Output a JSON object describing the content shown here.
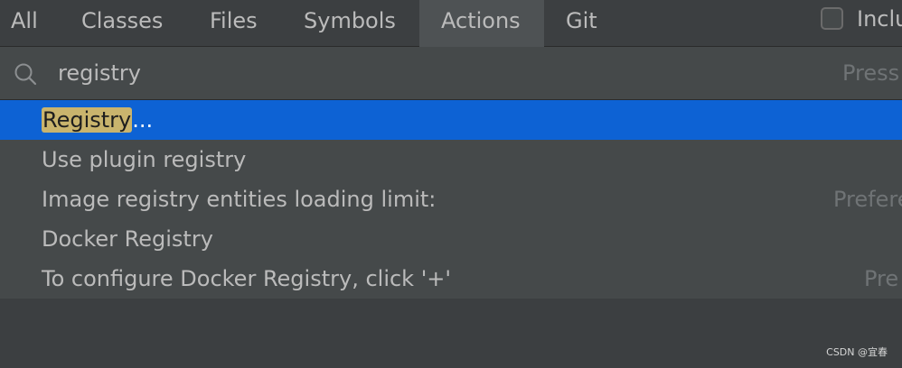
{
  "tabs": [
    {
      "label": "All",
      "active": false
    },
    {
      "label": "Classes",
      "active": false
    },
    {
      "label": "Files",
      "active": false
    },
    {
      "label": "Symbols",
      "active": false
    },
    {
      "label": "Actions",
      "active": true
    },
    {
      "label": "Git",
      "active": false
    }
  ],
  "include": {
    "label": "Inclu",
    "checked": false
  },
  "search": {
    "value": "registry",
    "hint": "Press"
  },
  "results": [
    {
      "match": "Registry",
      "rest": "...",
      "hint": "",
      "selected": true
    },
    {
      "label": "Use plugin registry",
      "hint": "",
      "selected": false
    },
    {
      "label": "Image registry entities loading limit:",
      "hint": "Prefere",
      "selected": false
    },
    {
      "label": "Docker Registry",
      "hint": "",
      "selected": false
    },
    {
      "label": "To configure Docker Registry, click '+'",
      "hint": "Pre",
      "selected": false
    }
  ],
  "watermark": "CSDN @宜春",
  "colors": {
    "selection": "#0d62d4",
    "highlight": "#c9b46d",
    "background": "#3c3f41"
  }
}
